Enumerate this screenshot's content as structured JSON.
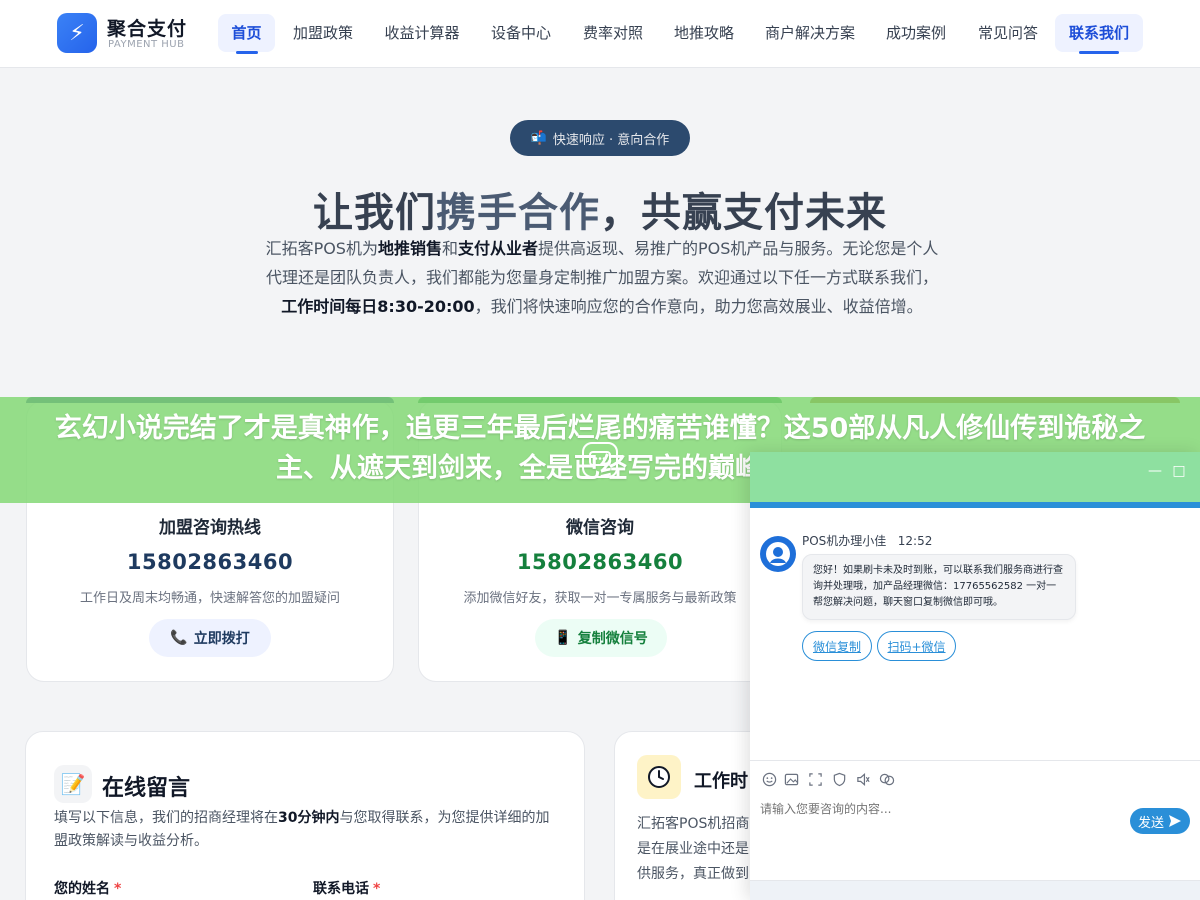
{
  "brand": {
    "title": "聚合支付",
    "subtitle": "PAYMENT HUB",
    "logo_icon": "lightning-icon",
    "accent": "#2563eb"
  },
  "nav": {
    "items": [
      {
        "label": "首页",
        "active": true
      },
      {
        "label": "加盟政策"
      },
      {
        "label": "收益计算器"
      },
      {
        "label": "设备中心"
      },
      {
        "label": "费率对照"
      },
      {
        "label": "地推攻略"
      },
      {
        "label": "商户解决方案"
      },
      {
        "label": "成功案例"
      },
      {
        "label": "常见问答"
      },
      {
        "label": "联系我们"
      }
    ]
  },
  "hero": {
    "badge": "快速响应 · 意向合作",
    "badge_icon": "mailbox-icon",
    "title_pre": "让我们",
    "title_hl": "携手合作",
    "title_post": "，共赢支付未来",
    "desc": {
      "p1": "汇拓客POS机为",
      "b1": "地推销售",
      "p2": "和",
      "b2": "支付从业者",
      "p3": "提供高返现、易推广的POS机产品与服务。无论您是个人代理还是团队负责人，我们都能为您量身定制推广加盟方案。欢迎通过以下任一方式联系我们，",
      "b3": "工作时间每日8:30-20:00",
      "p4": "，我们将快速响应您的合作意向，助力您高效展业、收益倍增。"
    }
  },
  "banner": {
    "text": "玄幻小说完结了才是真神作，追更三年最后烂尾的痛苦谁懂？这50部从凡人修仙传到诡秘之主、从遮天到剑来，全是已经写完的巅峰作品，够你看",
    "color": "#84d876"
  },
  "contact_cards": [
    {
      "title": "加盟咨询热线",
      "phone": "15802863460",
      "note": "工作日及周末均畅通，快速解答您的加盟疑问",
      "button": "立即拨打",
      "button_icon": "phone-icon",
      "phone_color": "#1e3a5f"
    },
    {
      "title": "微信咨询",
      "phone": "15802863460",
      "note": "添加微信好友，获取一对一专属服务与最新政策",
      "button": "复制微信号",
      "button_icon": "mobile-icon",
      "phone_color": "#15803d"
    }
  ],
  "message_card": {
    "title": "在线留言",
    "icon": "memo-icon",
    "desc_pre": "填写以下信息，我们的招商经理将在",
    "desc_bold": "30分钟内",
    "desc_post": "与您取得联系，为您提供详细的加盟政策解读与收益分析。",
    "name_label": "您的姓名",
    "phone_label": "联系电话",
    "required_mark": "*"
  },
  "hours_card": {
    "title": "工作时间",
    "title_visible": "工作时",
    "icon": "clock-icon",
    "lines": [
      "汇拓客POS机招商",
      "是在展业途中还是",
      "供服务，真正做到"
    ]
  },
  "chat": {
    "agent_name": "POS机办理小佳",
    "time": "12:52",
    "message": "您好！如果刷卡未及时到账，可以联系我们服务商进行查询并处理哦，加产品经理微信：17765562582 一对一帮您解决问题，聊天窗口复制微信即可哦。",
    "chips": [
      "微信复制",
      "扫码+微信"
    ],
    "input_placeholder": "请输入您要咨询的内容...",
    "send_label": "发送",
    "minimize": "—",
    "maximize": "□",
    "tools": [
      "smile-icon",
      "image-icon",
      "crop-icon",
      "shield-icon",
      "volume-icon",
      "history-icon"
    ]
  }
}
